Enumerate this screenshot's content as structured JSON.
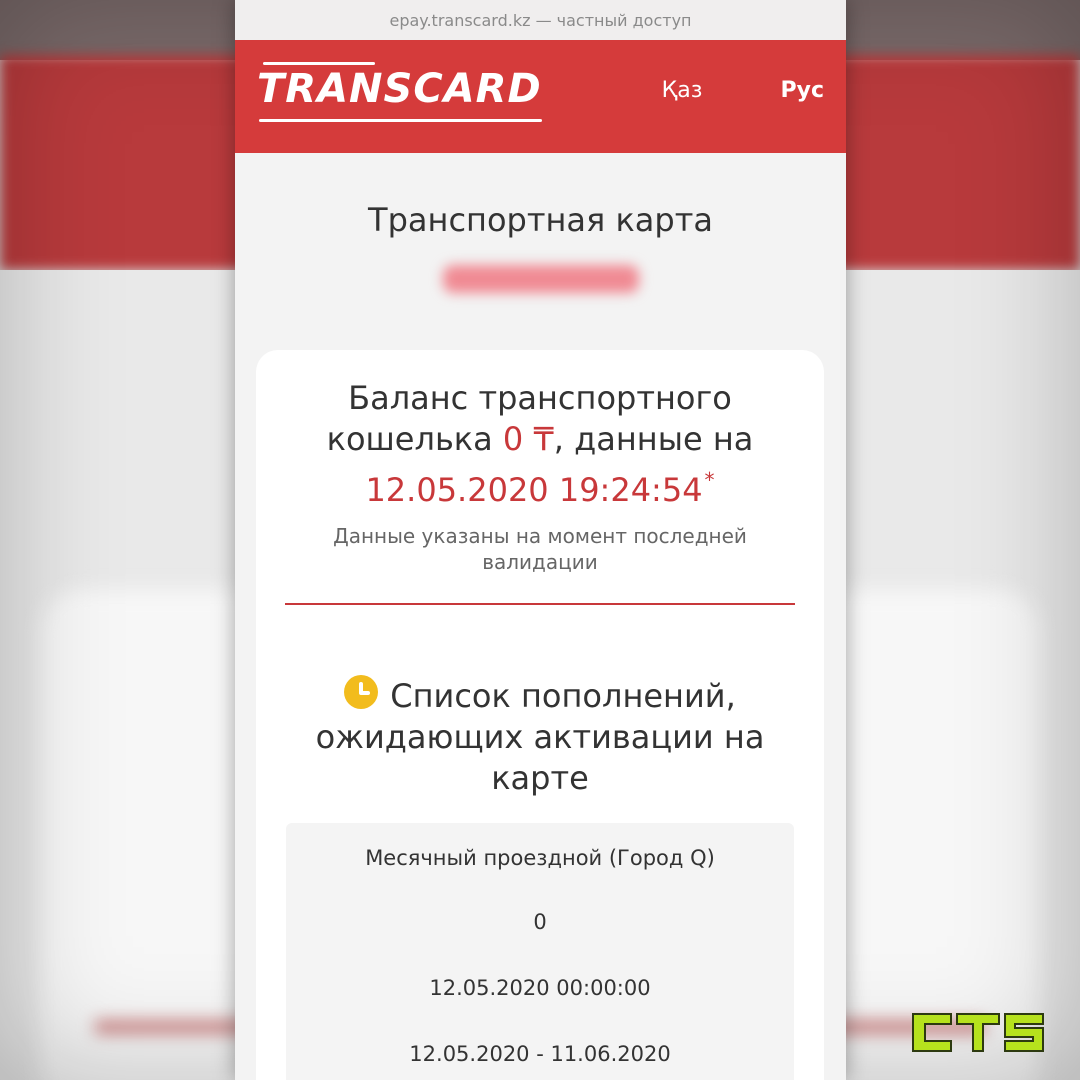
{
  "browser": {
    "url": "epay.transcard.kz — частный доступ"
  },
  "header": {
    "logo": "TRANSCARD",
    "languages": [
      {
        "label": "Қаз",
        "active": false
      },
      {
        "label": "Рус",
        "active": true
      }
    ]
  },
  "card": {
    "title": "Транспортная карта",
    "number_redacted": true
  },
  "balance": {
    "prefix": "Баланс транспортного кошелька",
    "amount": "0 ₸",
    "middle": ", данные на",
    "datetime": "12.05.2020 19:24:54",
    "asterisk": "*",
    "note": "Данные указаны на момент последней валидации"
  },
  "pending": {
    "icon": "clock-icon",
    "title": "Список пополнений, ожидающих активации на карте",
    "items": [
      {
        "name": "Месячный проездной (Город Q)",
        "amount": "0",
        "created": "12.05.2020 00:00:00",
        "period": "12.05.2020 - 11.06.2020"
      }
    ]
  },
  "colors": {
    "brand_red": "#d53b3b",
    "accent_red": "#c8383a",
    "clock_yellow": "#f2bc1d",
    "watermark_green": "#b6e21d"
  },
  "watermark": {
    "text": "CTS"
  }
}
